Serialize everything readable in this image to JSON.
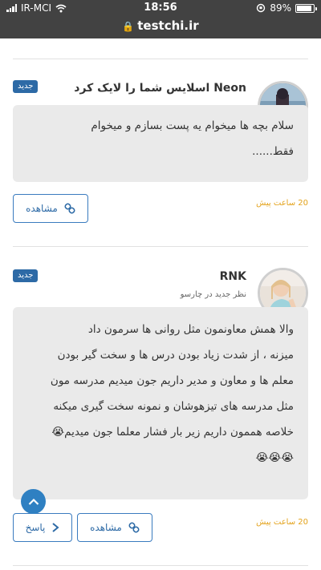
{
  "status": {
    "carrier": "IR-MCI",
    "time": "18:56",
    "battery": "89%",
    "battery_level": 0.89,
    "url": "testchi.ir"
  },
  "notifications": [
    {
      "title": "Neon اسلایس شما را لایک کرد",
      "badge": "جدید",
      "body": [
        "سلام بچه ها میخوام یه پست بسازم و میخوام",
        "فقط......"
      ],
      "time": "20 ساعت پیش",
      "view_label": "مشاهده"
    },
    {
      "title": "RNK",
      "subtitle": "نظر جدید در چارسو",
      "badge": "جدید",
      "body": [
        "والا همش معاونمون مثل روانی ها سرمون داد",
        "میزنه ، از شدت زیاد بودن درس ها و سخت گیر بودن",
        "معلم ها و معاون و مدیر داریم جون میدیم مدرسه مون",
        "مثل مدرسه های تیزهوشان و نمونه سخت گیری میکنه",
        "خلاصه هممون داریم زیر بار فشار معلما جون میدیم😭",
        "😭😭😭"
      ],
      "time": "20 ساعت پیش",
      "view_label": "مشاهده",
      "reply_label": "پاسخ"
    }
  ],
  "colors": {
    "accent": "#2d6aa6",
    "time": "#e3a21a",
    "statusbar": "#424242"
  }
}
